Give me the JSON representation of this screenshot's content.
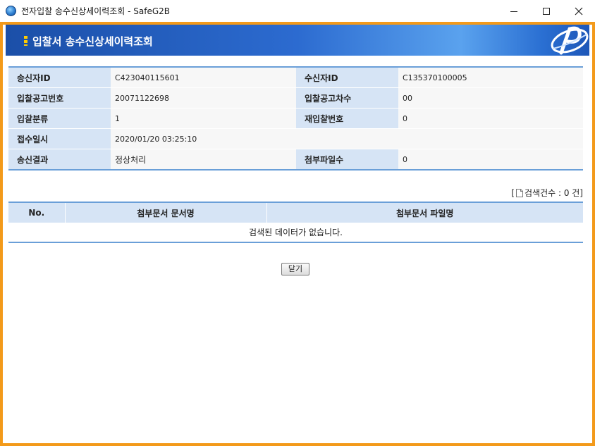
{
  "window": {
    "title": "전자입찰 송수신상세이력조회 - SafeG2B"
  },
  "banner": {
    "title": "입찰서 송수신상세이력조회"
  },
  "info": {
    "sender_id_label": "송신자ID",
    "sender_id": "C423040115601",
    "receiver_id_label": "수신자ID",
    "receiver_id": "C135370100005",
    "notice_no_label": "입찰공고번호",
    "notice_no": "20071122698",
    "notice_seq_label": "입찰공고차수",
    "notice_seq": "00",
    "bid_class_label": "입찰분류",
    "bid_class": "1",
    "rebid_no_label": "재입찰번호",
    "rebid_no": "0",
    "received_at_label": "접수일시",
    "received_at": "2020/01/20 03:25:10",
    "result_label": "송신결과",
    "result": "정상처리",
    "attach_count_label": "첨부파일수",
    "attach_count": "0"
  },
  "results": {
    "prefix": "[",
    "icon": "document-icon",
    "count_text": "검색건수 : 0 건]"
  },
  "grid": {
    "columns": [
      "No.",
      "첨부문서 문서명",
      "첨부문서 파일명"
    ],
    "empty_message": "검색된 데이터가 없습니다."
  },
  "close_button": {
    "label": "닫기"
  },
  "colors": {
    "frame_border": "#f39a1a",
    "banner_blue": "#2c6bd0",
    "label_bg": "#d6e4f5",
    "table_rule": "#6a9fd8"
  }
}
